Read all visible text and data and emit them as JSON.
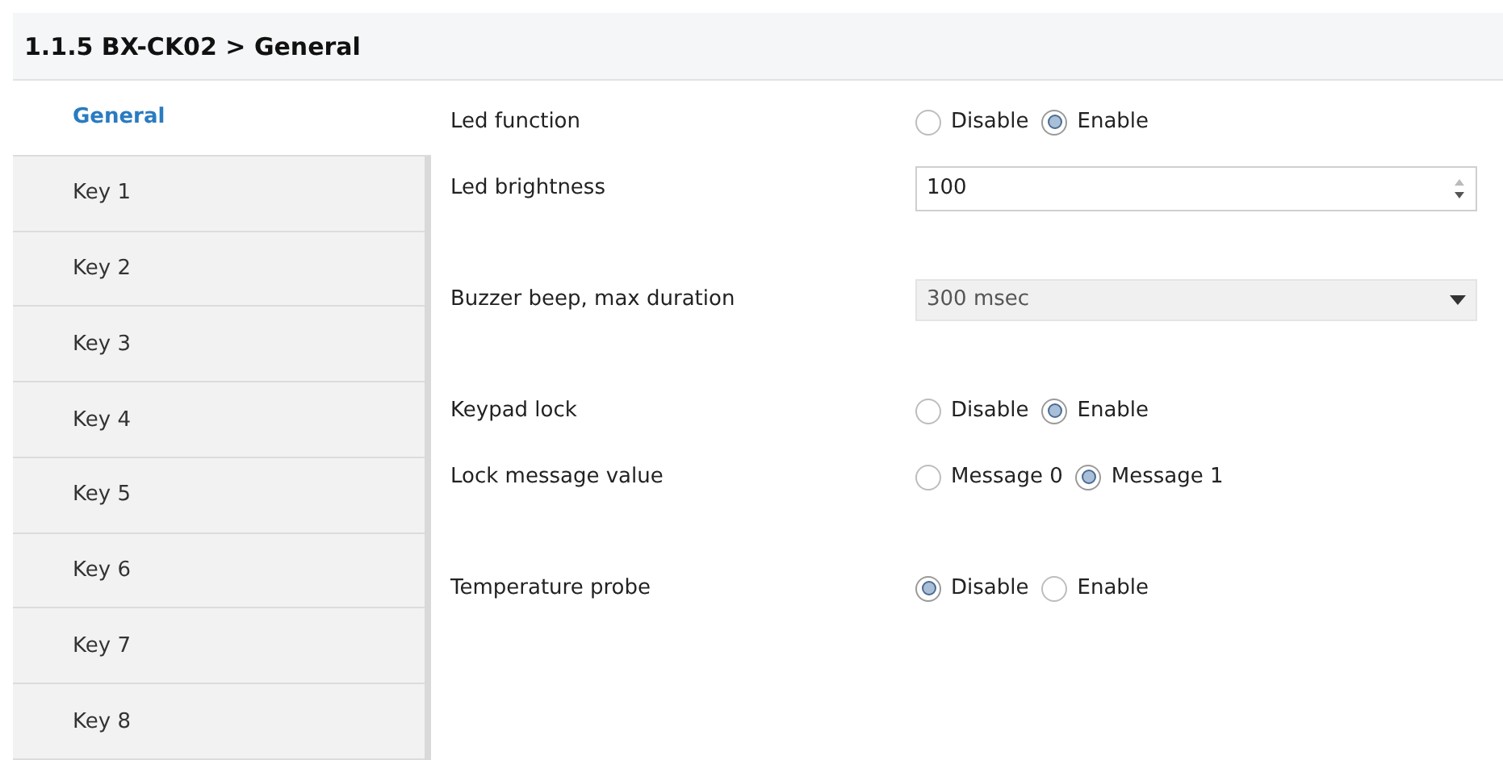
{
  "header": {
    "title": "1.1.5 BX-CK02 > General"
  },
  "sidebar": {
    "items": [
      {
        "label": "General",
        "selected": true
      },
      {
        "label": "Key 1",
        "selected": false
      },
      {
        "label": "Key 2",
        "selected": false
      },
      {
        "label": "Key 3",
        "selected": false
      },
      {
        "label": "Key 4",
        "selected": false
      },
      {
        "label": "Key 5",
        "selected": false
      },
      {
        "label": "Key 6",
        "selected": false
      },
      {
        "label": "Key 7",
        "selected": false
      },
      {
        "label": "Key 8",
        "selected": false
      }
    ]
  },
  "groups": [
    [
      {
        "kind": "radio",
        "label": "Led function",
        "options": [
          {
            "label": "Disable",
            "selected": false
          },
          {
            "label": "Enable",
            "selected": true
          }
        ]
      },
      {
        "kind": "number",
        "label": "Led brightness",
        "value": "100"
      }
    ],
    [
      {
        "kind": "select",
        "label": "Buzzer beep, max duration",
        "value": "300 msec"
      }
    ],
    [
      {
        "kind": "radio",
        "label": "Keypad lock",
        "options": [
          {
            "label": "Disable",
            "selected": false
          },
          {
            "label": "Enable",
            "selected": true
          }
        ]
      },
      {
        "kind": "radio",
        "label": "Lock message value",
        "options": [
          {
            "label": "Message 0",
            "selected": false
          },
          {
            "label": "Message 1",
            "selected": true
          }
        ]
      }
    ],
    [
      {
        "kind": "radio",
        "label": "Temperature probe",
        "options": [
          {
            "label": "Disable",
            "selected": true
          },
          {
            "label": "Enable",
            "selected": false
          }
        ]
      }
    ]
  ]
}
